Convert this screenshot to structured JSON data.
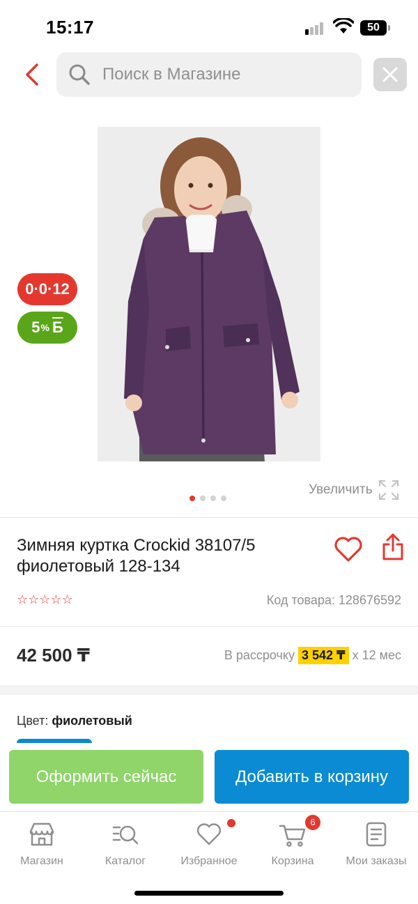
{
  "status_bar": {
    "time": "15:17",
    "battery": "50"
  },
  "search": {
    "placeholder": "Поиск в Магазине"
  },
  "product": {
    "badge_installment": "0·0·12",
    "badge_bonus_value": "5",
    "badge_bonus_percent": "%",
    "badge_bonus_letter": "Б",
    "zoom_label": "Увеличить",
    "gallery_total": 4,
    "gallery_active": 1,
    "title": "Зимняя куртка Crockid 38107/5 фиолетовый 128-134",
    "rating_stars": "☆☆☆☆☆",
    "sku": "Код товара: 128676592",
    "price": "42 500 ₸",
    "installment_prefix": "В рассрочку",
    "installment_amount": "3 542 ₸",
    "installment_suffix": "x 12 мес",
    "color_label": "Цвет:",
    "color_value": "фиолетовый"
  },
  "actions": {
    "checkout_label": "Оформить сейчас",
    "add_to_cart_label": "Добавить в корзину"
  },
  "nav": {
    "items": [
      {
        "label": "Магазин",
        "icon": "store-icon"
      },
      {
        "label": "Каталог",
        "icon": "catalog-search-icon"
      },
      {
        "label": "Избранное",
        "icon": "heart-icon"
      },
      {
        "label": "Корзина",
        "icon": "cart-icon",
        "count": "6"
      },
      {
        "label": "Мои заказы",
        "icon": "orders-icon"
      }
    ]
  },
  "colors": {
    "accent_red": "#e4382f",
    "bonus_green": "#5aa61a",
    "checkout_green": "#8fd56a",
    "cart_blue": "#0b8bd3",
    "installment_yellow": "#ffd100"
  }
}
